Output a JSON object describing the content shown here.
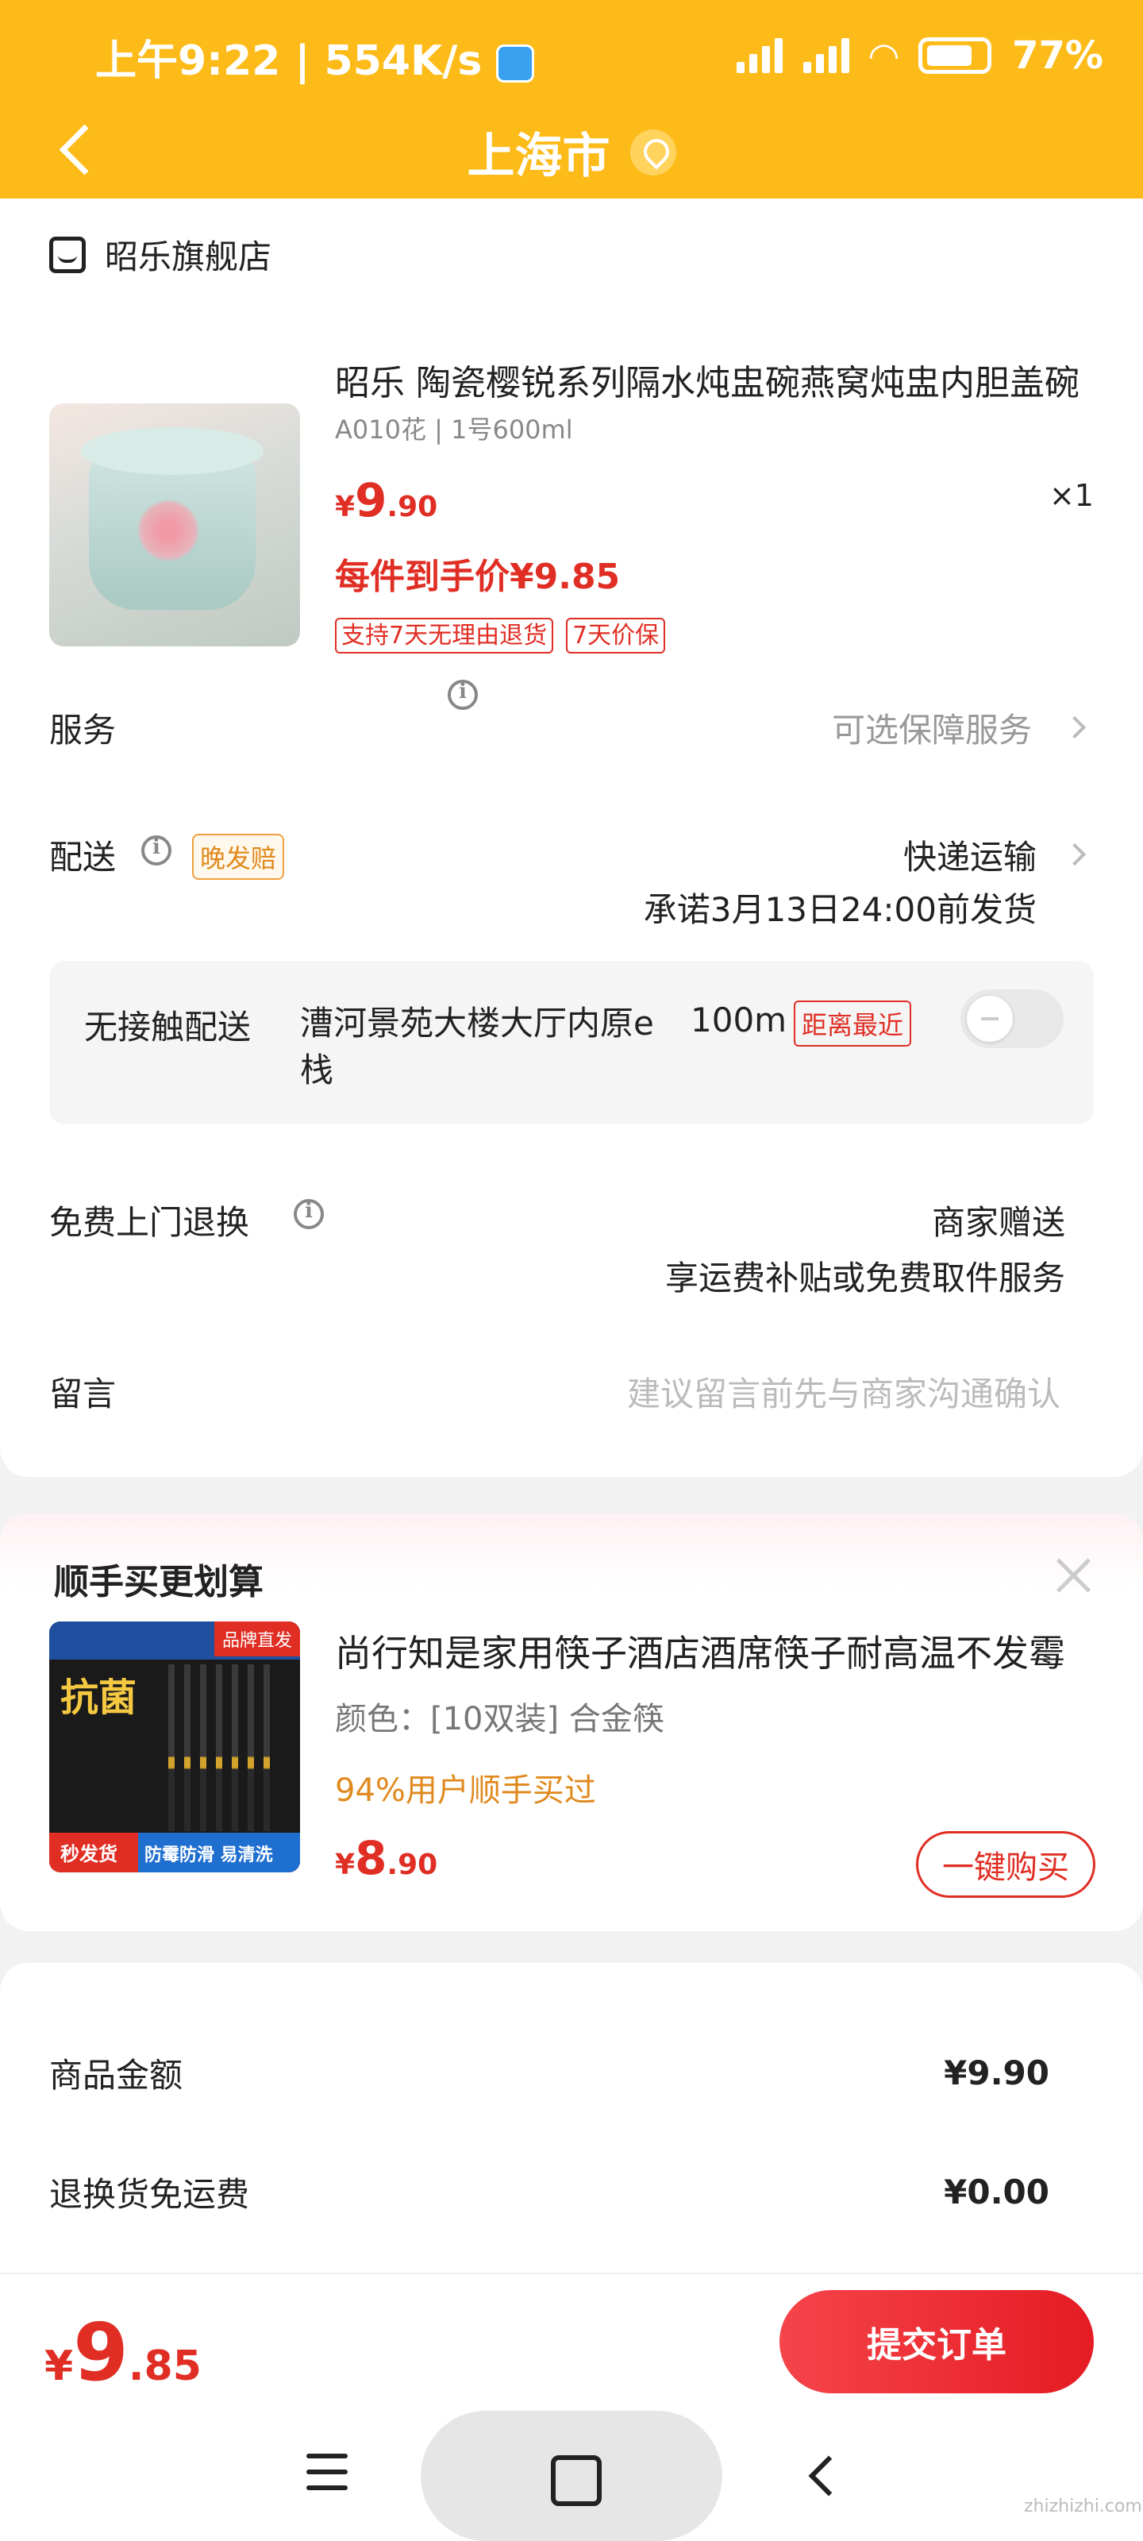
{
  "status_bar": {
    "time": "上午9:22 | 554K/s",
    "battery": "77%"
  },
  "header": {
    "city": "上海市"
  },
  "store": {
    "name": "昭乐旗舰店"
  },
  "product": {
    "title": "昭乐 陶瓷樱锐系列隔水炖盅碗燕窝炖盅内胆盖碗",
    "spec": "A010花 | 1号600ml",
    "price_symbol": "¥",
    "price_int": "9",
    "price_dec": ".90",
    "quantity": "×1",
    "final_price": "每件到手价¥9.85",
    "tags": [
      "支持7天无理由退货",
      "7天价保"
    ]
  },
  "service": {
    "label": "服务",
    "value": "可选保障服务"
  },
  "delivery": {
    "label": "配送",
    "badge": "晚发赔",
    "method": "快递运输",
    "promise": "承诺3月13日24:00前发货"
  },
  "no_contact": {
    "label": "无接触配送",
    "address": "漕河景苑大楼大厅内原e栈",
    "distance": "100m",
    "badge": "距离最近"
  },
  "free_return": {
    "label": "免费上门退换",
    "value_line1": "商家赠送",
    "value_line2": "享运费补贴或免费取件服务"
  },
  "message": {
    "label": "留言",
    "placeholder": "建议留言前先与商家沟通确认"
  },
  "addon": {
    "title": "顺手买更划算",
    "product_name": "尚行知是家用筷子酒店酒席筷子耐高温不发霉",
    "spec": "颜色：[10双装] 合金筷",
    "bought": "94%用户顺手买过",
    "price_symbol": "¥",
    "price_int": "8",
    "price_dec": ".90",
    "button": "一键购买",
    "img_badge": "品牌直发",
    "img_title": "抗菌",
    "img_tag1": "秒发货",
    "img_tag2": "防霉防滑 易清洗"
  },
  "summary": {
    "goods_label": "商品金额",
    "goods_value": "¥9.90",
    "return_label": "退换货免运费",
    "return_value": "¥0.00"
  },
  "bottom": {
    "total_symbol": "¥",
    "total_int": "9",
    "total_dec": ".85",
    "submit": "提交订单"
  },
  "watermark": "zhizhizhi.com",
  "colors": {
    "header": "#fdbb1a",
    "accent_red": "#e02e24",
    "orange": "#e08a1e"
  }
}
